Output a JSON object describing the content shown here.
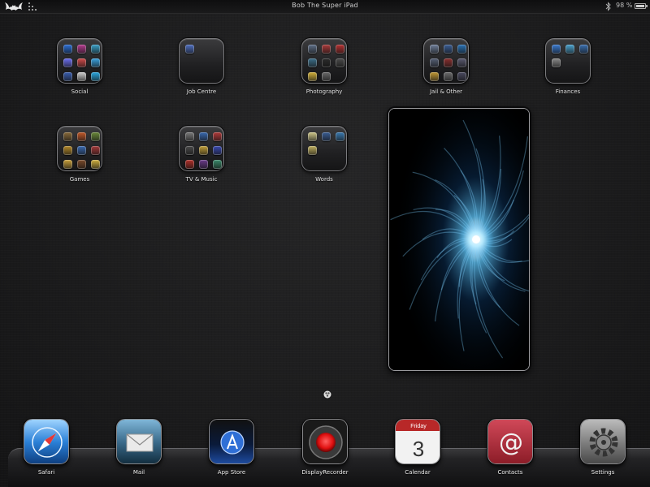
{
  "status_bar": {
    "carrier_logo": "bat-logo-icon",
    "signal": "signal-dots-icon",
    "device_name": "Bob The Super iPad",
    "bluetooth": "bluetooth-icon",
    "battery_percent": "98 %",
    "battery_level": 0.98
  },
  "folders": [
    {
      "name": "social",
      "label": "Social",
      "icon_colors": [
        "#2c6fd6",
        "#b43c8f",
        "#3aa0c8",
        "#6d6ff2",
        "#d14b4b",
        "#3aa3e0",
        "#3a5fb0",
        "#cfcfcf",
        "#2ba9e1"
      ]
    },
    {
      "name": "job-centre",
      "label": "Job Centre",
      "icon_colors": [
        "#4f6fc0"
      ]
    },
    {
      "name": "photography",
      "label": "Photography",
      "icon_colors": [
        "#5f6f88",
        "#a83a3a",
        "#b53131",
        "#3d6f8a",
        "#2b2b2b",
        "#4a4a4a",
        "#d4b23a",
        "#6a6a6a"
      ]
    },
    {
      "name": "jail-and-other",
      "label": "Jail & Other",
      "icon_colors": [
        "#6f7f9a",
        "#3a5e94",
        "#2a72b4",
        "#566075",
        "#8a3030",
        "#5a5a70",
        "#c29a35",
        "#6d6d6d",
        "#4a4a60"
      ]
    },
    {
      "name": "finances",
      "label": "Finances",
      "icon_colors": [
        "#3a7ad0",
        "#4aa3d0",
        "#3a6fb0",
        "#8a8a8a"
      ]
    },
    {
      "name": "games",
      "label": "Games",
      "icon_colors": [
        "#8a6b3a",
        "#c25a2a",
        "#6b8a3a",
        "#b58a2a",
        "#3a6ab0",
        "#a33a3a",
        "#c9a03a",
        "#7a4a2a",
        "#d0b040"
      ]
    },
    {
      "name": "tv-and-music",
      "label": "TV & Music",
      "icon_colors": [
        "#7a7a7a",
        "#3a6ab0",
        "#b03a3a",
        "#4a4a4a",
        "#c2a03a",
        "#3a4ab0",
        "#b0302a",
        "#6a3a8a",
        "#3a8a6a"
      ]
    },
    {
      "name": "words",
      "label": "Words",
      "icon_colors": [
        "#d0c88a",
        "#3a5e94",
        "#3a7ab0",
        "#c0b060"
      ]
    }
  ],
  "wallpaper_widget": {
    "icon": "starburst-wallpaper-image"
  },
  "page_indicator": {
    "icon": "page-dot-icon"
  },
  "dock": [
    {
      "name": "safari",
      "label": "Safari",
      "icon": "safari-compass-icon",
      "color": "#2a7fd6"
    },
    {
      "name": "mail",
      "label": "Mail",
      "icon": "mail-envelope-icon",
      "color": "#3a6a8a"
    },
    {
      "name": "app-store",
      "label": "App Store",
      "icon": "app-store-icon",
      "color": "#1f4fa8"
    },
    {
      "name": "display-recorder",
      "label": "DisplayRecorder",
      "icon": "record-icon",
      "color": "#e01010"
    },
    {
      "name": "calendar",
      "label": "Calendar",
      "icon": "calendar-icon",
      "weekday": "Friday",
      "day": "3",
      "color": "#b82828"
    },
    {
      "name": "contacts",
      "label": "Contacts",
      "icon": "contacts-at-icon",
      "color": "#8a1b26"
    },
    {
      "name": "settings",
      "label": "Settings",
      "icon": "settings-gear-icon",
      "color": "#7a7a7a"
    }
  ]
}
